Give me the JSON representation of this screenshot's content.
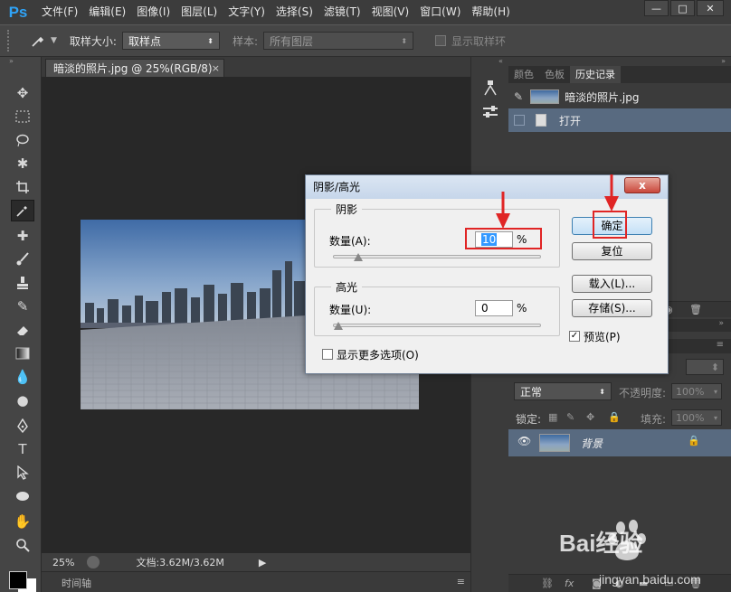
{
  "app": {
    "logo": "Ps",
    "menu": [
      "文件(F)",
      "编辑(E)",
      "图像(I)",
      "图层(L)",
      "文字(Y)",
      "选择(S)",
      "滤镜(T)",
      "视图(V)",
      "窗口(W)",
      "帮助(H)"
    ],
    "window_buttons": [
      "—",
      "□",
      "✕"
    ]
  },
  "options": {
    "sample_size_label": "取样大小:",
    "sample_size_value": "取样点",
    "sample_label": "样本:",
    "sample_value": "所有图层",
    "show_ring_label": "显示取样环"
  },
  "document": {
    "tab_title": "暗淡的照片.jpg @ 25%(RGB/8)",
    "tab_close": "×",
    "zoom": "25%",
    "doc_size": "文档:3.62M/3.62M",
    "timeline_label": "时间轴"
  },
  "history_panel": {
    "tabs": [
      "颜色",
      "色板",
      "历史记录"
    ],
    "snapshot_name": "暗淡的照片.jpg",
    "steps": [
      "打开"
    ]
  },
  "layers_panel": {
    "blend_mode": "正常",
    "opacity_label": "不透明度:",
    "opacity_value": "100%",
    "lock_label": "锁定:",
    "fill_label": "填充:",
    "fill_value": "100%",
    "layer_name": "背景"
  },
  "dialog": {
    "title": "阴影/高光",
    "close": "x",
    "shadows_group": "阴影",
    "shadows_amount_label": "数量(A):",
    "shadows_amount_value": "10",
    "percent": "%",
    "shadows_amount_fraction": 0.1,
    "highlights_group": "高光",
    "highlights_amount_label": "数量(U):",
    "highlights_amount_value": "0",
    "highlights_amount_fraction": 0,
    "more_options_label": "显示更多选项(O)",
    "ok": "确定",
    "reset": "复位",
    "load": "载入(L)...",
    "save": "存储(S)...",
    "preview_label": "预览(P)",
    "preview_checked": true
  },
  "watermark": {
    "brand": "Bai经验",
    "url": "jingyan.baidu.com"
  },
  "colors": {
    "accent_red": "#e02525",
    "selection_blue": "#586a80"
  }
}
